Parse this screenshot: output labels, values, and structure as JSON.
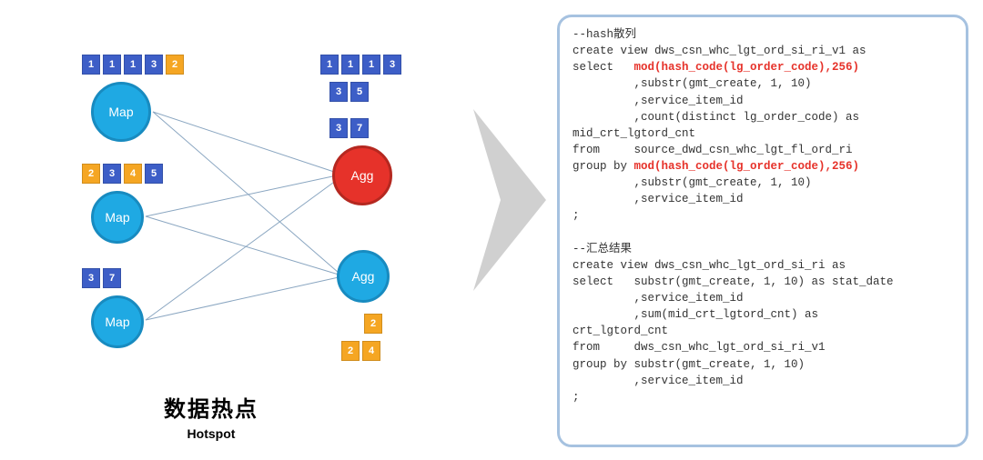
{
  "diagram": {
    "nodes": {
      "map1": "Map",
      "map2": "Map",
      "map3": "Map",
      "agg1": "Agg",
      "agg2": "Agg"
    },
    "chip_rows": {
      "map1_top": [
        {
          "val": "1",
          "color": "blue"
        },
        {
          "val": "1",
          "color": "blue"
        },
        {
          "val": "1",
          "color": "blue"
        },
        {
          "val": "3",
          "color": "blue"
        },
        {
          "val": "2",
          "color": "orange"
        }
      ],
      "map2_top": [
        {
          "val": "2",
          "color": "orange"
        },
        {
          "val": "3",
          "color": "blue"
        },
        {
          "val": "4",
          "color": "orange"
        },
        {
          "val": "5",
          "color": "blue"
        }
      ],
      "map3_top": [
        {
          "val": "3",
          "color": "blue"
        },
        {
          "val": "7",
          "color": "blue"
        }
      ],
      "agg1_top1": [
        {
          "val": "1",
          "color": "blue"
        },
        {
          "val": "1",
          "color": "blue"
        },
        {
          "val": "1",
          "color": "blue"
        },
        {
          "val": "3",
          "color": "blue"
        }
      ],
      "agg1_top2": [
        {
          "val": "3",
          "color": "blue"
        },
        {
          "val": "5",
          "color": "blue"
        }
      ],
      "agg1_top3": [
        {
          "val": "3",
          "color": "blue"
        },
        {
          "val": "7",
          "color": "blue"
        }
      ],
      "agg2_bot1": [
        {
          "val": "2",
          "color": "orange"
        }
      ],
      "agg2_bot2": [
        {
          "val": "2",
          "color": "orange"
        },
        {
          "val": "4",
          "color": "orange"
        }
      ]
    },
    "caption_cn": "数据热点",
    "caption_en": "Hotspot"
  },
  "code": {
    "block1_comment": "--hash散列",
    "block1_line1": "create view dws_csn_whc_lgt_ord_si_ri_v1 as",
    "block1_line2a": "select   ",
    "block1_line2b_red": "mod(hash_code(lg_order_code),256)",
    "block1_line3": "         ,substr(gmt_create, 1, 10)",
    "block1_line4": "         ,service_item_id",
    "block1_line5": "         ,count(distinct lg_order_code) as",
    "block1_line6": "mid_crt_lgtord_cnt",
    "block1_line7": "from     source_dwd_csn_whc_lgt_fl_ord_ri",
    "block1_line8a": "group by ",
    "block1_line8b_red": "mod(hash_code(lg_order_code),256)",
    "block1_line9": "         ,substr(gmt_create, 1, 10)",
    "block1_line10": "         ,service_item_id",
    "block1_line11": ";",
    "block2_comment": "--汇总结果",
    "block2_line1": "create view dws_csn_whc_lgt_ord_si_ri as",
    "block2_line2": "select   substr(gmt_create, 1, 10) as stat_date",
    "block2_line3": "         ,service_item_id",
    "block2_line4": "         ,sum(mid_crt_lgtord_cnt) as",
    "block2_line5": "crt_lgtord_cnt",
    "block2_line6": "from     dws_csn_whc_lgt_ord_si_ri_v1",
    "block2_line7": "group by substr(gmt_create, 1, 10)",
    "block2_line8": "         ,service_item_id",
    "block2_line9": ";"
  }
}
